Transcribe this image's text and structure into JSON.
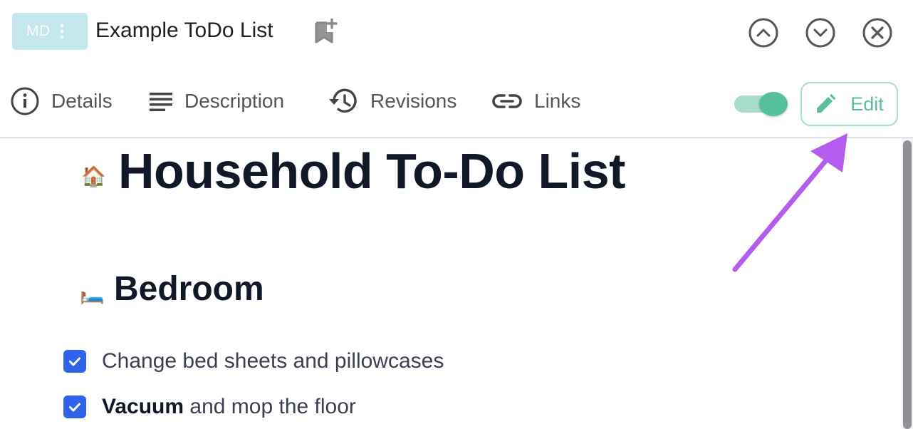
{
  "header": {
    "badge": "MD",
    "title": "Example ToDo List"
  },
  "tabs": [
    {
      "label": "Details",
      "icon": "info-icon"
    },
    {
      "label": "Description",
      "icon": "description-lines-icon"
    },
    {
      "label": "Revisions",
      "icon": "history-icon"
    },
    {
      "label": "Links",
      "icon": "link-icon"
    }
  ],
  "toolbar": {
    "toggle_on": true,
    "edit_label": "Edit"
  },
  "content": {
    "title_emoji": "🏠",
    "title": "Household To-Do List",
    "section_emoji": "🛏️",
    "section_heading": "Bedroom",
    "tasks": [
      {
        "checked": true,
        "bold": "",
        "text": "Change bed sheets and pillowcases"
      },
      {
        "checked": true,
        "bold": "Vacuum",
        "text": " and mop the floor"
      }
    ]
  },
  "colors": {
    "accent": "#56bf9e",
    "checkbox": "#2f62e8",
    "badge": "#c5e8ee",
    "annotation_arrow": "#b45cf0"
  }
}
